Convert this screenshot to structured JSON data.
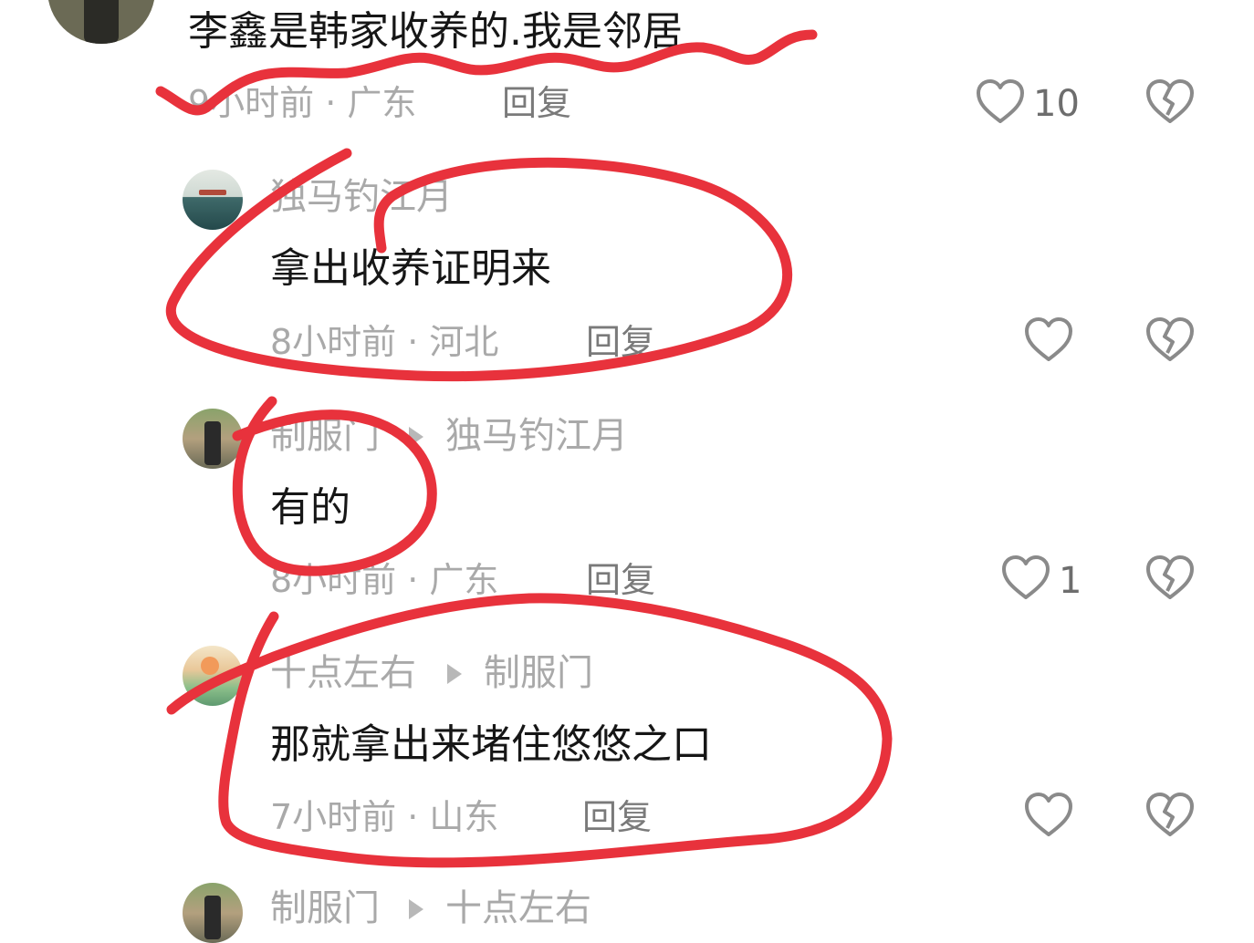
{
  "comments": [
    {
      "text": "李鑫是韩家收养的.我是邻居",
      "meta": "9小时前 · 广东",
      "reply": "回复",
      "likes": "10"
    },
    {
      "author": "独马钓江月",
      "text": "拿出收养证明来",
      "meta": "8小时前 · 河北",
      "reply": "回复",
      "likes": ""
    },
    {
      "author": "制服门",
      "reply_to": "独马钓江月",
      "text": "有的",
      "meta": "8小时前 · 广东",
      "reply": "回复",
      "likes": "1"
    },
    {
      "author": "十点左右",
      "reply_to": "制服门",
      "text": "那就拿出来堵住悠悠之口",
      "meta": "7小时前 · 山东",
      "reply": "回复",
      "likes": ""
    },
    {
      "author": "制服门",
      "reply_to": "十点左右",
      "text": "",
      "meta": "",
      "reply": "",
      "likes": ""
    }
  ],
  "colors": {
    "scribble": "#e8323c",
    "icon": "#8a8a8a",
    "muted_text": "#a9a9a9"
  },
  "icons": {
    "like": "heart-outline-icon",
    "dislike": "broken-heart-icon",
    "reply_arrow": "play-triangle-icon"
  }
}
